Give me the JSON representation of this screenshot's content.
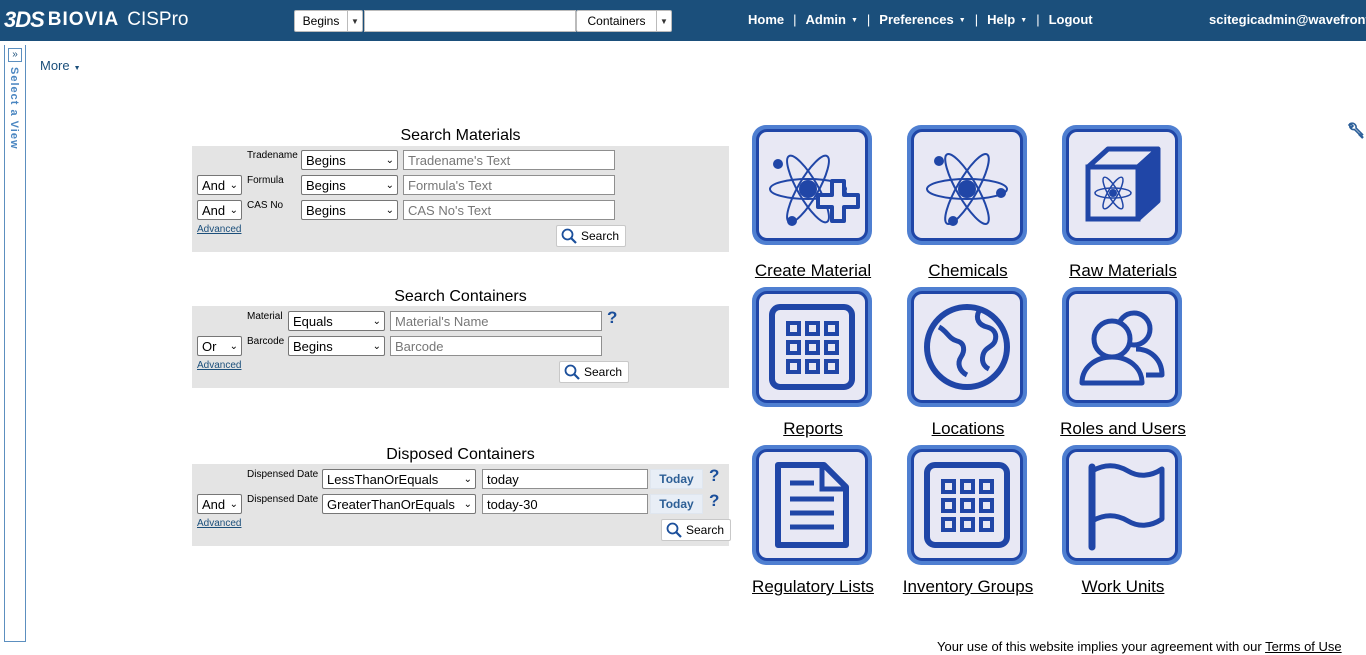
{
  "header": {
    "logo_mark": "3DS",
    "logo_brand": "BIOVIA",
    "logo_product": "CISPro",
    "search_mode": "Begins",
    "search_value": "",
    "search_scope": "Containers",
    "nav": [
      "Home",
      "Admin",
      "Preferences",
      "Help",
      "Logout"
    ],
    "user": "scitegicadmin@wavefront"
  },
  "sidebar": {
    "label": "Select a View"
  },
  "more_label": "More",
  "search_materials": {
    "title": "Search Materials",
    "rows": [
      {
        "conj": "",
        "label": "Tradename",
        "op": "Begins",
        "placeholder": "Tradename's Text"
      },
      {
        "conj": "And",
        "label": "Formula",
        "op": "Begins",
        "placeholder": "Formula's Text"
      },
      {
        "conj": "And",
        "label": "CAS No",
        "op": "Begins",
        "placeholder": "CAS No's Text"
      }
    ],
    "advanced": "Advanced",
    "search_btn": "Search"
  },
  "search_containers": {
    "title": "Search Containers",
    "rows": [
      {
        "conj": "",
        "label": "Material",
        "op": "Equals",
        "placeholder": "Material's Name"
      },
      {
        "conj": "Or",
        "label": "Barcode",
        "op": "Begins",
        "placeholder": "Barcode"
      }
    ],
    "advanced": "Advanced",
    "search_btn": "Search"
  },
  "disposed_containers": {
    "title": "Disposed Containers",
    "rows": [
      {
        "conj": "",
        "label": "Dispensed Date",
        "op": "LessThanOrEquals",
        "value": "today",
        "today_btn": "Today"
      },
      {
        "conj": "And",
        "label": "Dispensed Date",
        "op": "GreaterThanOrEquals",
        "value": "today-30",
        "today_btn": "Today"
      }
    ],
    "advanced": "Advanced",
    "search_btn": "Search"
  },
  "tiles": [
    {
      "label": "Create Material",
      "icon": "create-material-icon"
    },
    {
      "label": "Chemicals",
      "icon": "chemicals-icon"
    },
    {
      "label": "Raw Materials",
      "icon": "raw-materials-icon"
    },
    {
      "label": "Reports",
      "icon": "reports-icon"
    },
    {
      "label": "Locations",
      "icon": "locations-icon"
    },
    {
      "label": "Roles and Users",
      "icon": "roles-users-icon"
    },
    {
      "label": "Regulatory Lists",
      "icon": "regulatory-lists-icon"
    },
    {
      "label": "Inventory Groups",
      "icon": "inventory-groups-icon"
    },
    {
      "label": "Work Units",
      "icon": "work-units-icon"
    }
  ],
  "footer": {
    "text": "Your use of this website implies your agreement with our ",
    "link": "Terms of Use"
  },
  "colors": {
    "header_bg": "#1b4f7b",
    "tile_border": "#4f7fd1",
    "tile_stroke": "#2046a7",
    "panel_bg": "#e4e4e4"
  }
}
